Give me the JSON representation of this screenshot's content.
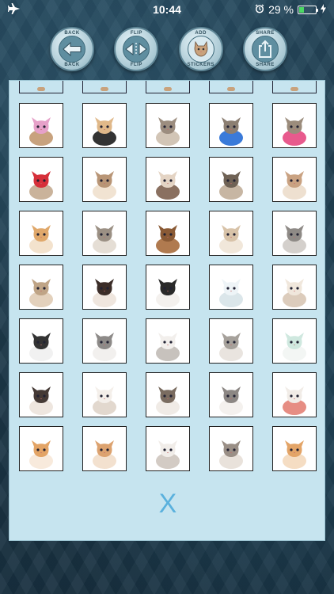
{
  "status_bar": {
    "time": "10:44",
    "battery_percent": "29 %",
    "battery_level": 0.29,
    "icons": [
      "airplane-icon",
      "alarm-icon",
      "battery-icon",
      "charging-icon"
    ]
  },
  "toolbar": {
    "buttons": [
      {
        "id": "back",
        "top_label": "BACK",
        "bottom_label": "BACK",
        "icon": "arrow-left-icon"
      },
      {
        "id": "flip",
        "top_label": "FLIP",
        "bottom_label": "FLIP",
        "icon": "flip-icon"
      },
      {
        "id": "add",
        "top_label": "ADD",
        "bottom_label": "STICKERS",
        "icon": "cat-sticker-icon"
      },
      {
        "id": "share",
        "top_label": "SHARE",
        "bottom_label": "SHARE",
        "icon": "share-icon"
      }
    ]
  },
  "stickers": [
    {
      "name": "cat-gift-bag",
      "colors": [
        "#e6a1c9",
        "#c8a27e"
      ]
    },
    {
      "name": "cat-laptop",
      "colors": [
        "#e0b889",
        "#333333"
      ]
    },
    {
      "name": "tabby-kittens-playing",
      "colors": [
        "#9c8d7f",
        "#d2c5b6"
      ]
    },
    {
      "name": "kitten-food-bowl",
      "colors": [
        "#8c7f72",
        "#3a7ad9"
      ]
    },
    {
      "name": "kitten-yarn-ball",
      "colors": [
        "#9b8c7c",
        "#e85a8d"
      ]
    },
    {
      "name": "kitten-gift-box",
      "colors": [
        "#d6303a",
        "#cab39b"
      ]
    },
    {
      "name": "tabby-kitten-walking",
      "colors": [
        "#b89576",
        "#f1e3d2"
      ]
    },
    {
      "name": "calico-kitten",
      "colors": [
        "#e4d4c4",
        "#8a7060"
      ]
    },
    {
      "name": "tabby-kitten-sitting",
      "colors": [
        "#6f6255",
        "#c7b6a3"
      ]
    },
    {
      "name": "scottish-fold-kitten",
      "colors": [
        "#c9a282",
        "#eee0d0"
      ]
    },
    {
      "name": "orange-kitten-lying",
      "colors": [
        "#e0a86b",
        "#f3e2cd"
      ]
    },
    {
      "name": "tabby-cat-sitting",
      "colors": [
        "#9b9084",
        "#e5ded5"
      ]
    },
    {
      "name": "abyssinian-cat",
      "colors": [
        "#8a5a35",
        "#b07a4f"
      ]
    },
    {
      "name": "british-cream-cat",
      "colors": [
        "#d8c3a9",
        "#f1e7da"
      ]
    },
    {
      "name": "silver-tabby-cat",
      "colors": [
        "#8e8a86",
        "#d4d0cc"
      ]
    },
    {
      "name": "british-golden-cat",
      "colors": [
        "#bfa486",
        "#e3d1bc"
      ]
    },
    {
      "name": "siamese-cat-face",
      "colors": [
        "#3b2d28",
        "#efe6de"
      ]
    },
    {
      "name": "tuxedo-cat-face",
      "colors": [
        "#2a2a2a",
        "#f4f1ee"
      ]
    },
    {
      "name": "white-persian-kitten",
      "colors": [
        "#eef4f7",
        "#dbe6ea"
      ]
    },
    {
      "name": "cream-persian-kitten",
      "colors": [
        "#f0e7dc",
        "#dcccbc"
      ]
    },
    {
      "name": "black-white-kitten",
      "colors": [
        "#333333",
        "#f1f1f1"
      ]
    },
    {
      "name": "grey-white-cat",
      "colors": [
        "#8d8a88",
        "#f2f0ee"
      ]
    },
    {
      "name": "white-cat-blue-eyes",
      "colors": [
        "#f2efec",
        "#c7c2bd"
      ]
    },
    {
      "name": "grey-tabby-cat",
      "colors": [
        "#a6a19b",
        "#e9e4df"
      ]
    },
    {
      "name": "white-cat-mint",
      "colors": [
        "#cfe8df",
        "#f3f6f4"
      ]
    },
    {
      "name": "siamese-cat",
      "colors": [
        "#453a36",
        "#eee6df"
      ]
    },
    {
      "name": "white-fluffy-cat",
      "colors": [
        "#f4efea",
        "#e2d8ce"
      ]
    },
    {
      "name": "tabby-white-cat",
      "colors": [
        "#7a6c60",
        "#f0ebe6"
      ]
    },
    {
      "name": "grey-white-cat-sitting",
      "colors": [
        "#8c8784",
        "#f4f1ee"
      ]
    },
    {
      "name": "white-cat-yawning",
      "colors": [
        "#f1ece7",
        "#e68d83"
      ]
    },
    {
      "name": "orange-white-kitten",
      "colors": [
        "#e3a466",
        "#f8eadc"
      ]
    },
    {
      "name": "orange-kitten-rolling",
      "colors": [
        "#dca26f",
        "#f3e1cf"
      ]
    },
    {
      "name": "white-cat-lying",
      "colors": [
        "#f1ede9",
        "#d3cbc4"
      ]
    },
    {
      "name": "kittens-sleeping",
      "colors": [
        "#9a8f86",
        "#e9e2db"
      ]
    },
    {
      "name": "orange-kitten-standing",
      "colors": [
        "#e3a467",
        "#f5ddc3"
      ]
    }
  ],
  "close_label": "X"
}
